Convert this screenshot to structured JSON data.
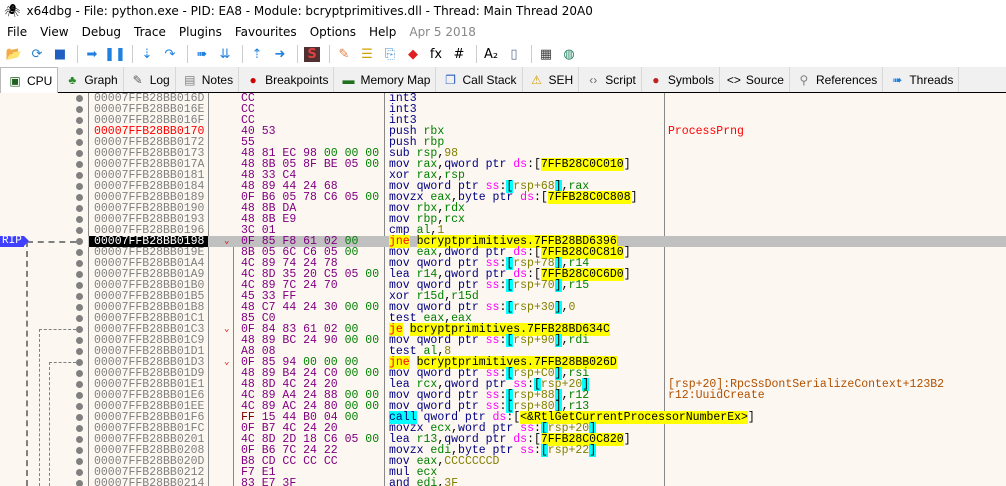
{
  "window": {
    "title": "x64dbg - File: python.exe - PID: EA8 - Module: bcryptprimitives.dll - Thread: Main Thread 20A0"
  },
  "menu": {
    "items": [
      "File",
      "View",
      "Debug",
      "Trace",
      "Plugins",
      "Favourites",
      "Options",
      "Help"
    ],
    "date": "Apr 5 2018"
  },
  "toolbar": [
    {
      "name": "open",
      "g": "📂",
      "c": "#d8a030"
    },
    {
      "name": "restart",
      "g": "⟳",
      "c": "#2080d0"
    },
    {
      "name": "stop",
      "g": "■",
      "c": "#2060c0"
    },
    "|",
    {
      "name": "run",
      "g": "➡",
      "c": "#2080e0"
    },
    {
      "name": "pause",
      "g": "❚❚",
      "c": "#2080e0"
    },
    "|",
    {
      "name": "step-into",
      "g": "⇣",
      "c": "#2080e0"
    },
    {
      "name": "step-over",
      "g": "↷",
      "c": "#2080e0"
    },
    "|",
    {
      "name": "trace-into",
      "g": "➠",
      "c": "#2080e0"
    },
    {
      "name": "trace-over",
      "g": "⇊",
      "c": "#2080e0"
    },
    "|",
    {
      "name": "execute-till-return",
      "g": "⇡",
      "c": "#2080e0"
    },
    {
      "name": "run-to-user-code",
      "g": "➜",
      "c": "#2080e0"
    },
    "|",
    {
      "name": "scylla",
      "g": "S",
      "c": "#c03030"
    },
    "|",
    {
      "name": "patches",
      "g": "✎",
      "c": "#e08040"
    },
    {
      "name": "comments",
      "g": "☰",
      "c": "#d0a000"
    },
    {
      "name": "labels",
      "g": "⎘",
      "c": "#4090d0"
    },
    {
      "name": "bookmarks",
      "g": "◆",
      "c": "#e02020"
    },
    {
      "name": "functions",
      "g": "fx",
      "c": "#000"
    },
    {
      "name": "hash",
      "g": "#",
      "c": "#000"
    },
    "|",
    {
      "name": "font",
      "g": "A₂",
      "c": "#000"
    },
    {
      "name": "device",
      "g": "▯",
      "c": "#607090"
    },
    "|",
    {
      "name": "calculator",
      "g": "▦",
      "c": "#404040"
    },
    {
      "name": "globe",
      "g": "◍",
      "c": "#208060"
    }
  ],
  "tabs": [
    {
      "label": "CPU",
      "icon": "cpu",
      "g": "▣",
      "c": "#206020",
      "active": true
    },
    {
      "label": "Graph",
      "icon": "tree",
      "g": "♣",
      "c": "#2a8a2a"
    },
    {
      "label": "Log",
      "icon": "log",
      "g": "✎",
      "c": "#606060"
    },
    {
      "label": "Notes",
      "icon": "notes",
      "g": "▤",
      "c": "#808080"
    },
    {
      "label": "Breakpoints",
      "icon": "breakpoint",
      "g": "●",
      "c": "#d00000"
    },
    {
      "label": "Memory Map",
      "icon": "memory",
      "g": "▬",
      "c": "#207020"
    },
    {
      "label": "Call Stack",
      "icon": "callstack",
      "g": "❐",
      "c": "#3060c0"
    },
    {
      "label": "SEH",
      "icon": "seh",
      "g": "⚠",
      "c": "#d0a000"
    },
    {
      "label": "Script",
      "icon": "script",
      "g": "‹›",
      "c": "#607060"
    },
    {
      "label": "Symbols",
      "icon": "symbols",
      "g": "●",
      "c": "#c02020"
    },
    {
      "label": "Source",
      "icon": "source",
      "g": "<>",
      "c": "#000"
    },
    {
      "label": "References",
      "icon": "search",
      "g": "⚲",
      "c": "#808080"
    },
    {
      "label": "Threads",
      "icon": "threads",
      "g": "➠",
      "c": "#2080e0"
    }
  ],
  "rip_label": "RIP",
  "rows": [
    {
      "addr": "00007FFB28BB016D",
      "bytes": "CC",
      "ins": [
        [
          "int3",
          "m"
        ]
      ]
    },
    {
      "addr": "00007FFB28BB016E",
      "bytes": "CC",
      "ins": [
        [
          "int3",
          "m"
        ]
      ]
    },
    {
      "addr": "00007FFB28BB016F",
      "bytes": "CC",
      "ins": [
        [
          "int3",
          "m"
        ]
      ]
    },
    {
      "addr": "00007FFB28BB0170",
      "label": true,
      "bytes": "40 53",
      "ins": [
        [
          "push ",
          "m"
        ],
        [
          "rbx",
          "r"
        ]
      ],
      "comment": "ProcessPrng",
      "ctype": "lbl"
    },
    {
      "addr": "00007FFB28BB0172",
      "bytes": "55",
      "ins": [
        [
          "push ",
          "m"
        ],
        [
          "rbp",
          "r"
        ]
      ]
    },
    {
      "addr": "00007FFB28BB0173",
      "bytes": "48 81 EC 98 00 00 00",
      "ins": [
        [
          "sub ",
          "m"
        ],
        [
          "rsp",
          "r"
        ],
        [
          ",",
          "p"
        ],
        [
          "98",
          "n"
        ]
      ]
    },
    {
      "addr": "00007FFB28BB017A",
      "bytes": "48 8B 05 8F BE 05 00",
      "ins": [
        [
          "mov ",
          "m"
        ],
        [
          "rax",
          "r"
        ],
        [
          ",",
          "p"
        ],
        [
          "qword ptr ",
          "m"
        ],
        [
          "ds",
          "s"
        ],
        [
          ":[",
          "p"
        ],
        [
          "7FFB28C0C010",
          "a"
        ],
        [
          "]",
          "p"
        ]
      ]
    },
    {
      "addr": "00007FFB28BB0181",
      "bytes": "48 33 C4",
      "ins": [
        [
          "xor ",
          "m"
        ],
        [
          "rax",
          "r"
        ],
        [
          ",",
          "p"
        ],
        [
          "rsp",
          "r"
        ]
      ]
    },
    {
      "addr": "00007FFB28BB0184",
      "bytes": "48 89 44 24 68",
      "ins": [
        [
          "mov ",
          "m"
        ],
        [
          "qword ptr ",
          "m"
        ],
        [
          "ss",
          "s"
        ],
        [
          ":",
          "p"
        ],
        [
          "[",
          "b"
        ],
        [
          "rsp+68",
          "n"
        ],
        [
          "]",
          "b"
        ],
        [
          ",",
          "p"
        ],
        [
          "rax",
          "r"
        ]
      ]
    },
    {
      "addr": "00007FFB28BB0189",
      "bytes": "0F B6 05 78 C6 05 00",
      "ins": [
        [
          "movzx ",
          "m"
        ],
        [
          "eax",
          "r"
        ],
        [
          ",",
          "p"
        ],
        [
          "byte ptr ",
          "m"
        ],
        [
          "ds",
          "s"
        ],
        [
          ":[",
          "p"
        ],
        [
          "7FFB28C0C808",
          "a"
        ],
        [
          "]",
          "p"
        ]
      ]
    },
    {
      "addr": "00007FFB28BB0190",
      "bytes": "48 8B DA",
      "ins": [
        [
          "mov ",
          "m"
        ],
        [
          "rbx",
          "r"
        ],
        [
          ",",
          "p"
        ],
        [
          "rdx",
          "r"
        ]
      ]
    },
    {
      "addr": "00007FFB28BB0193",
      "bytes": "48 8B E9",
      "ins": [
        [
          "mov ",
          "m"
        ],
        [
          "rbp",
          "r"
        ],
        [
          ",",
          "p"
        ],
        [
          "rcx",
          "r"
        ]
      ]
    },
    {
      "addr": "00007FFB28BB0196",
      "bytes": "3C 01",
      "ins": [
        [
          "cmp ",
          "m"
        ],
        [
          "al",
          "r"
        ],
        [
          ",",
          "p"
        ],
        [
          "1",
          "n"
        ]
      ]
    },
    {
      "addr": "00007FFB28BB0198",
      "rip": true,
      "jump": true,
      "bytes": "0F 85 F8 61 02 00",
      "ins": [
        [
          "jne",
          "j"
        ],
        [
          " ",
          "p"
        ],
        [
          "bcryptprimitives.7FFB28BD6396",
          "jt"
        ]
      ]
    },
    {
      "addr": "00007FFB28BB019E",
      "bytes": "8B 05 6C C6 05 00",
      "ins": [
        [
          "mov ",
          "m"
        ],
        [
          "eax",
          "r"
        ],
        [
          ",",
          "p"
        ],
        [
          "dword ptr ",
          "m"
        ],
        [
          "ds",
          "s"
        ],
        [
          ":[",
          "p"
        ],
        [
          "7FFB28C0C810",
          "a"
        ],
        [
          "]",
          "p"
        ]
      ]
    },
    {
      "addr": "00007FFB28BB01A4",
      "bytes": "4C 89 74 24 78",
      "ins": [
        [
          "mov ",
          "m"
        ],
        [
          "qword ptr ",
          "m"
        ],
        [
          "ss",
          "s"
        ],
        [
          ":",
          "p"
        ],
        [
          "[",
          "b"
        ],
        [
          "rsp+78",
          "n"
        ],
        [
          "]",
          "b"
        ],
        [
          ",",
          "p"
        ],
        [
          "r14",
          "r"
        ]
      ]
    },
    {
      "addr": "00007FFB28BB01A9",
      "bytes": "4C 8D 35 20 C5 05 00",
      "ins": [
        [
          "lea ",
          "m"
        ],
        [
          "r14",
          "r"
        ],
        [
          ",",
          "p"
        ],
        [
          "qword ptr ",
          "m"
        ],
        [
          "ds",
          "s"
        ],
        [
          ":[",
          "p"
        ],
        [
          "7FFB28C0C6D0",
          "a"
        ],
        [
          "]",
          "p"
        ]
      ]
    },
    {
      "addr": "00007FFB28BB01B0",
      "bytes": "4C 89 7C 24 70",
      "ins": [
        [
          "mov ",
          "m"
        ],
        [
          "qword ptr ",
          "m"
        ],
        [
          "ss",
          "s"
        ],
        [
          ":",
          "p"
        ],
        [
          "[",
          "b"
        ],
        [
          "rsp+70",
          "n"
        ],
        [
          "]",
          "b"
        ],
        [
          ",",
          "p"
        ],
        [
          "r15",
          "r"
        ]
      ]
    },
    {
      "addr": "00007FFB28BB01B5",
      "bytes": "45 33 FF",
      "ins": [
        [
          "xor ",
          "m"
        ],
        [
          "r15d",
          "r"
        ],
        [
          ",",
          "p"
        ],
        [
          "r15d",
          "r"
        ]
      ]
    },
    {
      "addr": "00007FFB28BB01B8",
      "bytes": "48 C7 44 24 30 00 00",
      "ins": [
        [
          "mov ",
          "m"
        ],
        [
          "qword ptr ",
          "m"
        ],
        [
          "ss",
          "s"
        ],
        [
          ":",
          "p"
        ],
        [
          "[",
          "b"
        ],
        [
          "rsp+30",
          "n"
        ],
        [
          "]",
          "b"
        ],
        [
          ",",
          "p"
        ],
        [
          "0",
          "n"
        ]
      ]
    },
    {
      "addr": "00007FFB28BB01C1",
      "bytes": "85 C0",
      "ins": [
        [
          "test ",
          "m"
        ],
        [
          "eax",
          "r"
        ],
        [
          ",",
          "p"
        ],
        [
          "eax",
          "r"
        ]
      ]
    },
    {
      "addr": "00007FFB28BB01C3",
      "jump": true,
      "bytes": "0F 84 83 61 02 00",
      "ins": [
        [
          "je",
          "j"
        ],
        [
          " ",
          "p"
        ],
        [
          "bcryptprimitives.7FFB28BD634C",
          "jt"
        ]
      ]
    },
    {
      "addr": "00007FFB28BB01C9",
      "bytes": "48 89 BC 24 90 00 00",
      "ins": [
        [
          "mov ",
          "m"
        ],
        [
          "qword ptr ",
          "m"
        ],
        [
          "ss",
          "s"
        ],
        [
          ":",
          "p"
        ],
        [
          "[",
          "b"
        ],
        [
          "rsp+90",
          "n"
        ],
        [
          "]",
          "b"
        ],
        [
          ",",
          "p"
        ],
        [
          "rdi",
          "r"
        ]
      ]
    },
    {
      "addr": "00007FFB28BB01D1",
      "bytes": "A8 08",
      "ins": [
        [
          "test ",
          "m"
        ],
        [
          "al",
          "r"
        ],
        [
          ",",
          "p"
        ],
        [
          "8",
          "n"
        ]
      ]
    },
    {
      "addr": "00007FFB28BB01D3",
      "jump": true,
      "bytes": "0F 85 94 00 00 00",
      "ins": [
        [
          "jne",
          "j"
        ],
        [
          " ",
          "p"
        ],
        [
          "bcryptprimitives.7FFB28BB026D",
          "jt"
        ]
      ]
    },
    {
      "addr": "00007FFB28BB01D9",
      "bytes": "48 89 B4 24 C0 00 00",
      "ins": [
        [
          "mov ",
          "m"
        ],
        [
          "qword ptr ",
          "m"
        ],
        [
          "ss",
          "s"
        ],
        [
          ":",
          "p"
        ],
        [
          "[",
          "b"
        ],
        [
          "rsp+C0",
          "n"
        ],
        [
          "]",
          "b"
        ],
        [
          ",",
          "p"
        ],
        [
          "rsi",
          "r"
        ]
      ]
    },
    {
      "addr": "00007FFB28BB01E1",
      "bytes": "48 8D 4C 24 20",
      "ins": [
        [
          "lea ",
          "m"
        ],
        [
          "rcx",
          "r"
        ],
        [
          ",",
          "p"
        ],
        [
          "qword ptr ",
          "m"
        ],
        [
          "ss",
          "s"
        ],
        [
          ":",
          "p"
        ],
        [
          "[",
          "b"
        ],
        [
          "rsp+20",
          "n"
        ],
        [
          "]",
          "b"
        ]
      ],
      "comment": "[rsp+20]:RpcSsDontSerializeContext+123B2",
      "ctype": "auto"
    },
    {
      "addr": "00007FFB28BB01E6",
      "bytes": "4C 89 A4 24 88 00 00",
      "ins": [
        [
          "mov ",
          "m"
        ],
        [
          "qword ptr ",
          "m"
        ],
        [
          "ss",
          "s"
        ],
        [
          ":",
          "p"
        ],
        [
          "[",
          "b"
        ],
        [
          "rsp+88",
          "n"
        ],
        [
          "]",
          "b"
        ],
        [
          ",",
          "p"
        ],
        [
          "r12",
          "r"
        ]
      ],
      "comment": "r12:UuidCreate",
      "ctype": "auto"
    },
    {
      "addr": "00007FFB28BB01EE",
      "bytes": "4C 89 AC 24 80 00 00",
      "ins": [
        [
          "mov ",
          "m"
        ],
        [
          "qword ptr ",
          "m"
        ],
        [
          "ss",
          "s"
        ],
        [
          ":",
          "p"
        ],
        [
          "[",
          "b"
        ],
        [
          "rsp+80",
          "n"
        ],
        [
          "]",
          "b"
        ],
        [
          ",",
          "p"
        ],
        [
          "r13",
          "r"
        ]
      ]
    },
    {
      "addr": "00007FFB28BB01F6",
      "bytes": "FF 15 44 B0 04 00",
      "ins": [
        [
          "call",
          "c"
        ],
        [
          " qword ptr ",
          "m"
        ],
        [
          "ds",
          "s"
        ],
        [
          ":[",
          "p"
        ],
        [
          "<&RtlGetCurrentProcessorNumberEx>",
          "a"
        ],
        [
          "]",
          "p"
        ]
      ]
    },
    {
      "addr": "00007FFB28BB01FC",
      "bytes": "0F B7 4C 24 20",
      "ins": [
        [
          "movzx ",
          "m"
        ],
        [
          "ecx",
          "r"
        ],
        [
          ",",
          "p"
        ],
        [
          "word ptr ",
          "m"
        ],
        [
          "ss",
          "s"
        ],
        [
          ":",
          "p"
        ],
        [
          "[",
          "b"
        ],
        [
          "rsp+20",
          "n"
        ],
        [
          "]",
          "b"
        ]
      ]
    },
    {
      "addr": "00007FFB28BB0201",
      "bytes": "4C 8D 2D 18 C6 05 00",
      "ins": [
        [
          "lea ",
          "m"
        ],
        [
          "r13",
          "r"
        ],
        [
          ",",
          "p"
        ],
        [
          "qword ptr ",
          "m"
        ],
        [
          "ds",
          "s"
        ],
        [
          ":[",
          "p"
        ],
        [
          "7FFB28C0C820",
          "a"
        ],
        [
          "]",
          "p"
        ]
      ]
    },
    {
      "addr": "00007FFB28BB0208",
      "bytes": "0F B6 7C 24 22",
      "ins": [
        [
          "movzx ",
          "m"
        ],
        [
          "edi",
          "r"
        ],
        [
          ",",
          "p"
        ],
        [
          "byte ptr ",
          "m"
        ],
        [
          "ss",
          "s"
        ],
        [
          ":",
          "p"
        ],
        [
          "[",
          "b"
        ],
        [
          "rsp+22",
          "n"
        ],
        [
          "]",
          "b"
        ]
      ]
    },
    {
      "addr": "00007FFB28BB020D",
      "bytes": "B8 CD CC CC CC",
      "ins": [
        [
          "mov ",
          "m"
        ],
        [
          "eax",
          "r"
        ],
        [
          ",",
          "p"
        ],
        [
          "CCCCCCCD",
          "n"
        ]
      ]
    },
    {
      "addr": "00007FFB28BB0212",
      "bytes": "F7 E1",
      "ins": [
        [
          "mul ",
          "m"
        ],
        [
          "ecx",
          "r"
        ]
      ]
    },
    {
      "addr": "00007FFB28BB0214",
      "bytes": "83 E7 3F",
      "ins": [
        [
          "and ",
          "m"
        ],
        [
          "edi",
          "r"
        ],
        [
          ",",
          "p"
        ],
        [
          "3F",
          "n"
        ]
      ]
    }
  ]
}
